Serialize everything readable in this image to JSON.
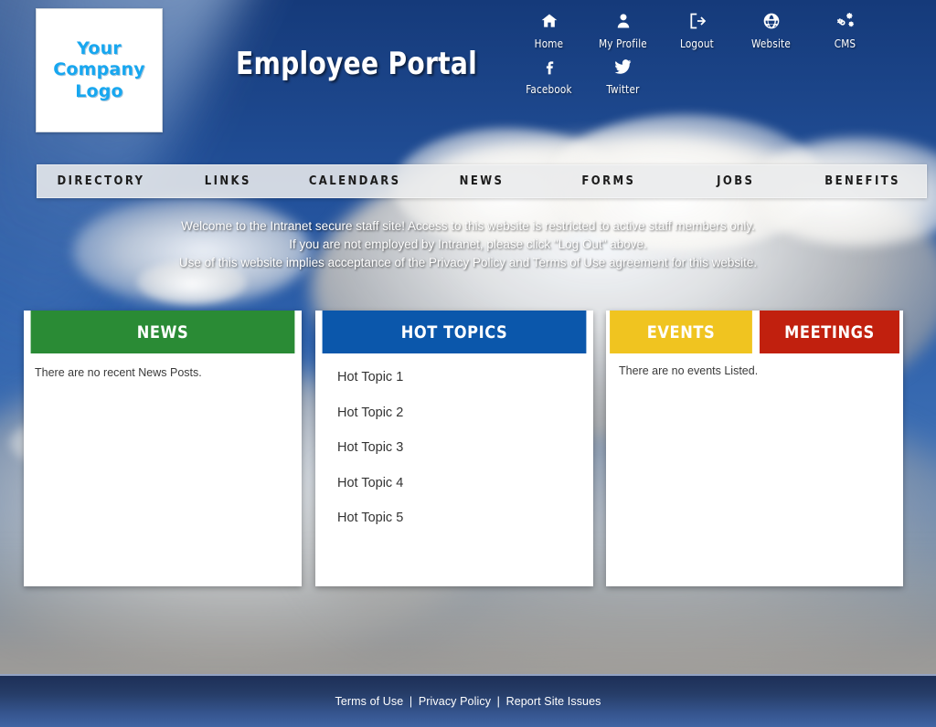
{
  "header": {
    "logo_line1": "Your",
    "logo_line2": "Company",
    "logo_line3": "Logo",
    "portal_title": "Employee Portal",
    "icon_nav": [
      {
        "label": "Home",
        "icon": "home-icon"
      },
      {
        "label": "My Profile",
        "icon": "person-icon"
      },
      {
        "label": "Logout",
        "icon": "logout-icon"
      },
      {
        "label": "Website",
        "icon": "globe-icon"
      },
      {
        "label": "CMS",
        "icon": "gears-icon"
      },
      {
        "label": "Facebook",
        "icon": "facebook-icon"
      },
      {
        "label": "Twitter",
        "icon": "twitter-icon"
      }
    ]
  },
  "main_nav": [
    {
      "label": "DIRECTORY"
    },
    {
      "label": "LINKS"
    },
    {
      "label": "CALENDARS"
    },
    {
      "label": "NEWS"
    },
    {
      "label": "FORMS"
    },
    {
      "label": "JOBS"
    },
    {
      "label": "BENEFITS"
    }
  ],
  "welcome": {
    "line1": "Welcome to the Intranet secure staff site! Access to this website is restricted to active staff members only.",
    "line2": "If you are not employed by Intranet, please click \"Log Out\" above.",
    "line3": "Use of this website implies acceptance of the Privacy Policy and Terms of Use agreement for this website."
  },
  "panels": {
    "news": {
      "title": "NEWS",
      "color": "#2a8b35",
      "empty_message": "There are no recent News Posts."
    },
    "hot_topics": {
      "title": "HOT TOPICS",
      "color": "#0b57ab",
      "items": [
        {
          "label": "Hot Topic 1"
        },
        {
          "label": "Hot Topic 2"
        },
        {
          "label": "Hot Topic 3"
        },
        {
          "label": "Hot Topic 4"
        },
        {
          "label": "Hot Topic 5"
        }
      ]
    },
    "events": {
      "tab_events": "EVENTS",
      "tab_meetings": "MEETINGS",
      "events_color": "#f0c420",
      "meetings_color": "#c1200e",
      "empty_message": "There are no events Listed."
    }
  },
  "footer": {
    "terms": "Terms of Use",
    "privacy": "Privacy Policy",
    "report": "Report Site Issues",
    "separator": "|"
  }
}
